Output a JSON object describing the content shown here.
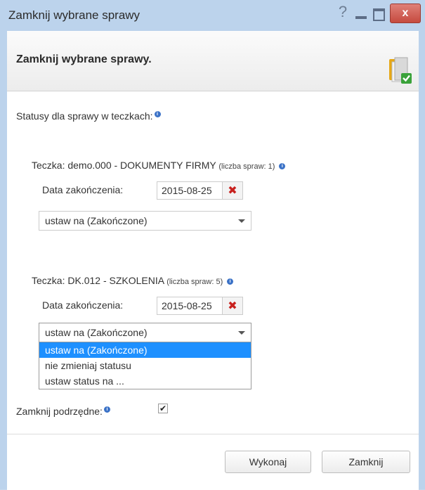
{
  "window": {
    "title": "Zamknij wybrane sprawy",
    "help_glyph": "?",
    "close_glyph": "x"
  },
  "header": {
    "title": "Zamknij wybrane sprawy.",
    "icon": "folder-check-icon"
  },
  "statuses": {
    "label": "Statusy dla sprawy w teczkach:"
  },
  "folders": [
    {
      "label": "Teczka: demo.000 - DOKUMENTY FIRMY",
      "count_label": "(liczba spraw: 1)",
      "date_label": "Data zakończenia:",
      "date_value": "2015-08-25",
      "select_value": "ustaw na  (Zakończone)"
    },
    {
      "label": "Teczka: DK.012 - SZKOLENIA",
      "count_label": "(liczba spraw: 5)",
      "date_label": "Data zakończenia:",
      "date_value": "2015-08-25",
      "select_value": "ustaw na  (Zakończone)",
      "options": [
        "ustaw na (Zakończone)",
        "nie zmieniaj statusu",
        "ustaw status na ..."
      ],
      "selected_option": 0
    }
  ],
  "close_children": {
    "label": "Zamknij podrzędne:",
    "checked": true,
    "check_glyph": "✔"
  },
  "buttons": {
    "execute": "Wykonaj",
    "close": "Zamknij"
  },
  "colors": {
    "titlebar": "#bcd3ec",
    "selected_option": "#1e90ff",
    "clear_icon": "#c8211e",
    "info_icon": "#3b72c7"
  }
}
